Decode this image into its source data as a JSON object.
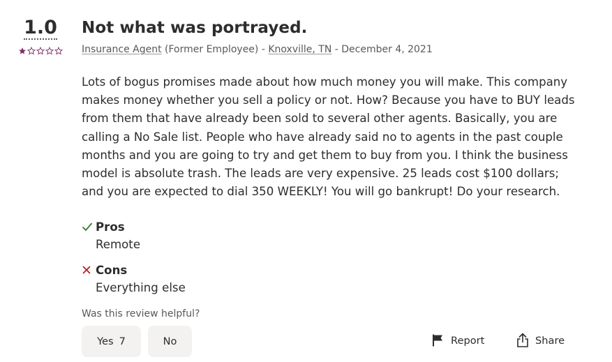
{
  "rating": {
    "value": "1.0",
    "stars_filled": 1,
    "stars_total": 5,
    "star_color": "#7d2f6b"
  },
  "review": {
    "title": "Not what was portrayed.",
    "job_title": "Insurance Agent",
    "employment_status": "(Former Employee)",
    "separator_1": " - ",
    "location": "Knoxville, TN",
    "separator_2": " - ",
    "date": "December 4, 2021",
    "body": "Lots of bogus promises made about how much money you will make. This company makes money whether you sell a policy or not. How? Because you have to BUY leads from them that have already been sold to several other agents. Basically, you are calling a No Sale list. People who have already said no to agents in the past couple months and you are going to try and get them to buy from you. I think the business model is absolute trash. The leads are very expensive. 25 leads cost $100 dollars; and you are expected to dial 350 WEEKLY! You will go bankrupt! Do your research."
  },
  "pros": {
    "heading": "Pros",
    "text": "Remote",
    "icon": "check-icon",
    "icon_color": "#2e7d32"
  },
  "cons": {
    "heading": "Cons",
    "text": "Everything else",
    "icon": "x-icon",
    "icon_color": "#b71c1c"
  },
  "helpful": {
    "question": "Was this review helpful?",
    "yes_label": "Yes",
    "yes_count": "7",
    "no_label": "No"
  },
  "actions": {
    "report_label": "Report",
    "share_label": "Share"
  }
}
